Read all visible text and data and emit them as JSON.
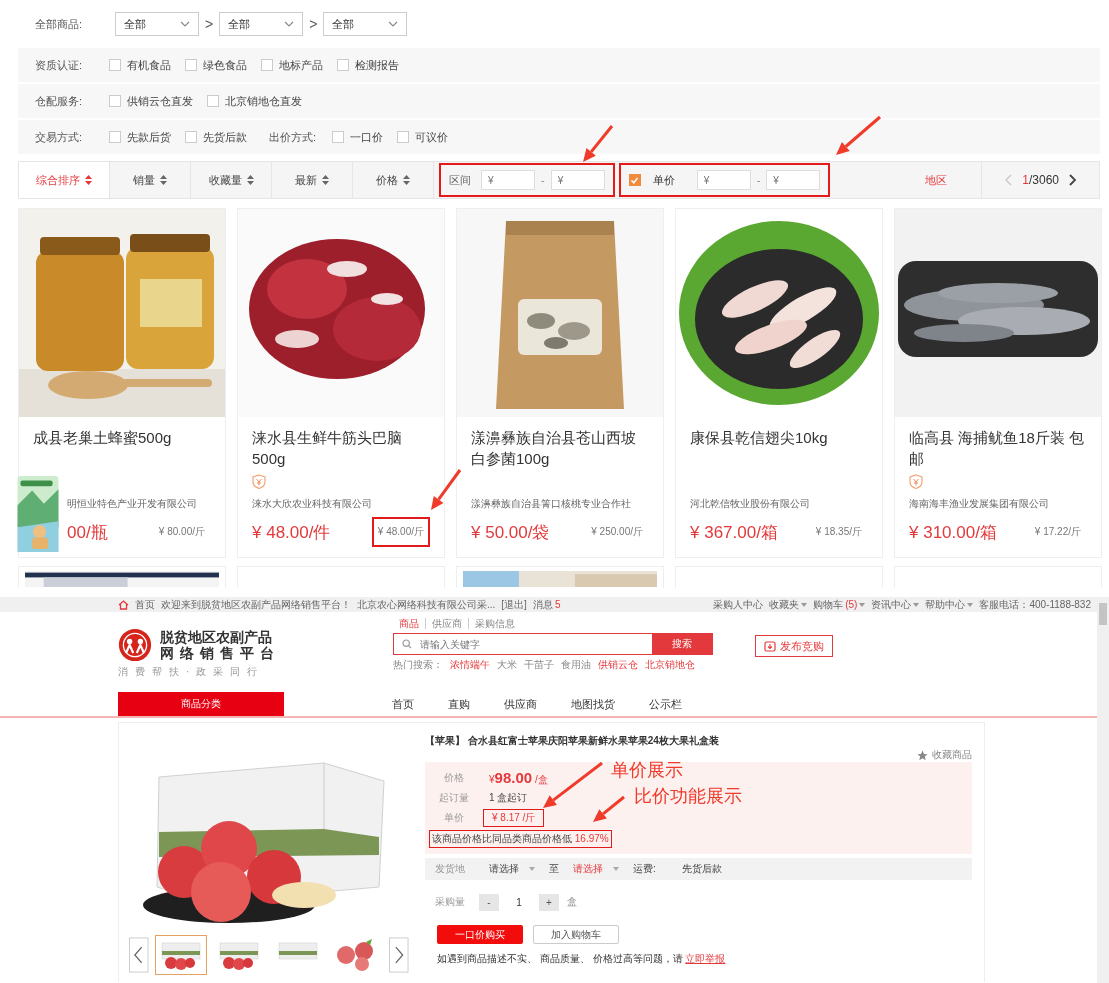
{
  "category_filter": {
    "label": "全部商品:",
    "selects": [
      "全部",
      "全部",
      "全部"
    ],
    "separator": ">"
  },
  "filter_rows": [
    {
      "label": "资质认证:",
      "items": [
        {
          "kind": "checkbox",
          "label": "有机食品",
          "checked": false
        },
        {
          "kind": "checkbox",
          "label": "绿色食品",
          "checked": false
        },
        {
          "kind": "checkbox",
          "label": "地标产品",
          "checked": false
        },
        {
          "kind": "checkbox",
          "label": "检测报告",
          "checked": false
        }
      ]
    },
    {
      "label": "仓配服务:",
      "items": [
        {
          "kind": "checkbox",
          "label": "供销云仓直发",
          "checked": false
        },
        {
          "kind": "checkbox",
          "label": "北京销地仓直发",
          "checked": false
        }
      ]
    },
    {
      "label": "交易方式:",
      "items": [
        {
          "kind": "checkbox",
          "label": "先款后货",
          "checked": false
        },
        {
          "kind": "checkbox",
          "label": "先货后款",
          "checked": false
        },
        {
          "kind": "label",
          "label": "出价方式:"
        },
        {
          "kind": "checkbox",
          "label": "一口价",
          "checked": false
        },
        {
          "kind": "checkbox",
          "label": "可议价",
          "checked": false
        }
      ]
    }
  ],
  "sort_bar": {
    "sorts": [
      {
        "label": "综合排序",
        "selected": true
      },
      {
        "label": "销量",
        "selected": false
      },
      {
        "label": "收藏量",
        "selected": false
      },
      {
        "label": "最新",
        "selected": false
      },
      {
        "label": "价格",
        "selected": false
      }
    ],
    "range": {
      "label": "区间",
      "min_placeholder": "¥",
      "separator": "-",
      "max_placeholder": "¥",
      "boxed": true
    },
    "unit_price": {
      "label": "单价",
      "checked": true,
      "min_placeholder": "¥",
      "separator": "-",
      "max_placeholder": "¥",
      "boxed": true
    },
    "region": "地区",
    "pager": {
      "current": "1",
      "total": "/3060"
    }
  },
  "products": [
    {
      "title": "成县老巢土蜂蜜500g",
      "badge": false,
      "company": "明恒业特色产业开发有限公司",
      "price": "00/瓶",
      "unit_price": "¥ 80.00/斤",
      "boxed": false
    },
    {
      "title": "涞水县生鲜牛筋头巴脑500g",
      "badge": true,
      "company": "涞水大欣农业科技有限公司",
      "price": "¥ 48.00/件",
      "unit_price": "¥ 48.00/斤",
      "boxed": true
    },
    {
      "title": "漾濞彝族自治县苍山西坡白参菌100g",
      "badge": false,
      "company": "漾濞彝族自治县箐口核桃专业合作社",
      "price": "¥ 50.00/袋",
      "unit_price": "¥ 250.00/斤",
      "boxed": false
    },
    {
      "title": "康保县乾信翅尖10kg",
      "badge": false,
      "company": "河北乾信牧业股份有限公司",
      "price": "¥ 367.00/箱",
      "unit_price": "¥ 18.35/斤",
      "boxed": false
    },
    {
      "title": "临高县 海捕鱿鱼18斤装 包邮",
      "badge": true,
      "company": "海南海丰渔业发展集团有限公司",
      "price": "¥ 310.00/箱",
      "unit_price": "¥ 17.22/斤",
      "boxed": false
    }
  ],
  "top_bar": {
    "home": "首页",
    "welcome": "欢迎来到脱贫地区农副产品网络销售平台！",
    "account": "北京农心网络科技有限公司采...",
    "logout": "[退出]",
    "messages_label": "消息",
    "messages_count": "5",
    "links": [
      {
        "label": "采购人中心",
        "dropdown": false
      },
      {
        "label": "收藏夹",
        "dropdown": true
      },
      {
        "label": "购物车",
        "count": "(5)",
        "dropdown": true
      },
      {
        "label": "资讯中心",
        "dropdown": true
      },
      {
        "label": "帮助中心",
        "dropdown": true
      }
    ],
    "hotline": "客服电话：400-1188-832"
  },
  "header": {
    "logo_title": "脱贫地区农副产品",
    "logo_subtitle": "网络销售平台",
    "slogan": "消费帮扶·政采同行",
    "search_tabs": [
      {
        "label": "商品",
        "selected": true
      },
      {
        "label": "供应商",
        "selected": false
      },
      {
        "label": "采购信息",
        "selected": false
      }
    ],
    "search_placeholder": "请输入关键字",
    "search_button": "搜索",
    "hot_label": "热门搜索：",
    "hot_items": [
      {
        "label": "浓情端午",
        "highlighted": true
      },
      {
        "label": "大米",
        "highlighted": false
      },
      {
        "label": "干苗子",
        "highlighted": false
      },
      {
        "label": "食用油",
        "highlighted": false
      },
      {
        "label": "供销云仓",
        "highlighted": true
      },
      {
        "label": "北京销地仓",
        "highlighted": true
      }
    ],
    "publish_button": "发布竞购"
  },
  "nav": {
    "category": "商品分类",
    "items": [
      "首页",
      "直购",
      "供应商",
      "地图找货",
      "公示栏"
    ]
  },
  "detail": {
    "title": "【苹果】 合水县红富士苹果庆阳苹果新鲜水果苹果24枚大果礼盒装",
    "favorite": "收藏商品",
    "price_label": "价格",
    "price_symbol": "¥",
    "price": "98.00",
    "price_unit": "/盒",
    "moq_label": "起订量",
    "moq": "1 盒起订",
    "unit_label": "单价",
    "unit_price": "¥  8.17 /斤",
    "unit_boxed": true,
    "compare_text": "该商品价格比同品类商品价格低",
    "compare_value": "16.97%",
    "compare_boxed": true,
    "ship": {
      "from_label": "发货地",
      "from": "请选择",
      "to_label": "至",
      "to": "请选择",
      "fee_label": "运费:",
      "fee": "先货后款"
    },
    "qty": {
      "label": "采购量",
      "minus": "-",
      "value": "1",
      "plus": "+",
      "unit": "盒"
    },
    "buy_button": "一口价购买",
    "cart_button": "加入购物车",
    "report_text": "如遇到商品描述不实、 商品质量、 价格过高等问题，请",
    "report_link": "立即举报",
    "thumbnails": [
      {
        "selected": true
      },
      {
        "selected": false
      },
      {
        "selected": false
      },
      {
        "selected": false
      }
    ]
  },
  "annotations": [
    "单价展示",
    "比价功能展示"
  ]
}
